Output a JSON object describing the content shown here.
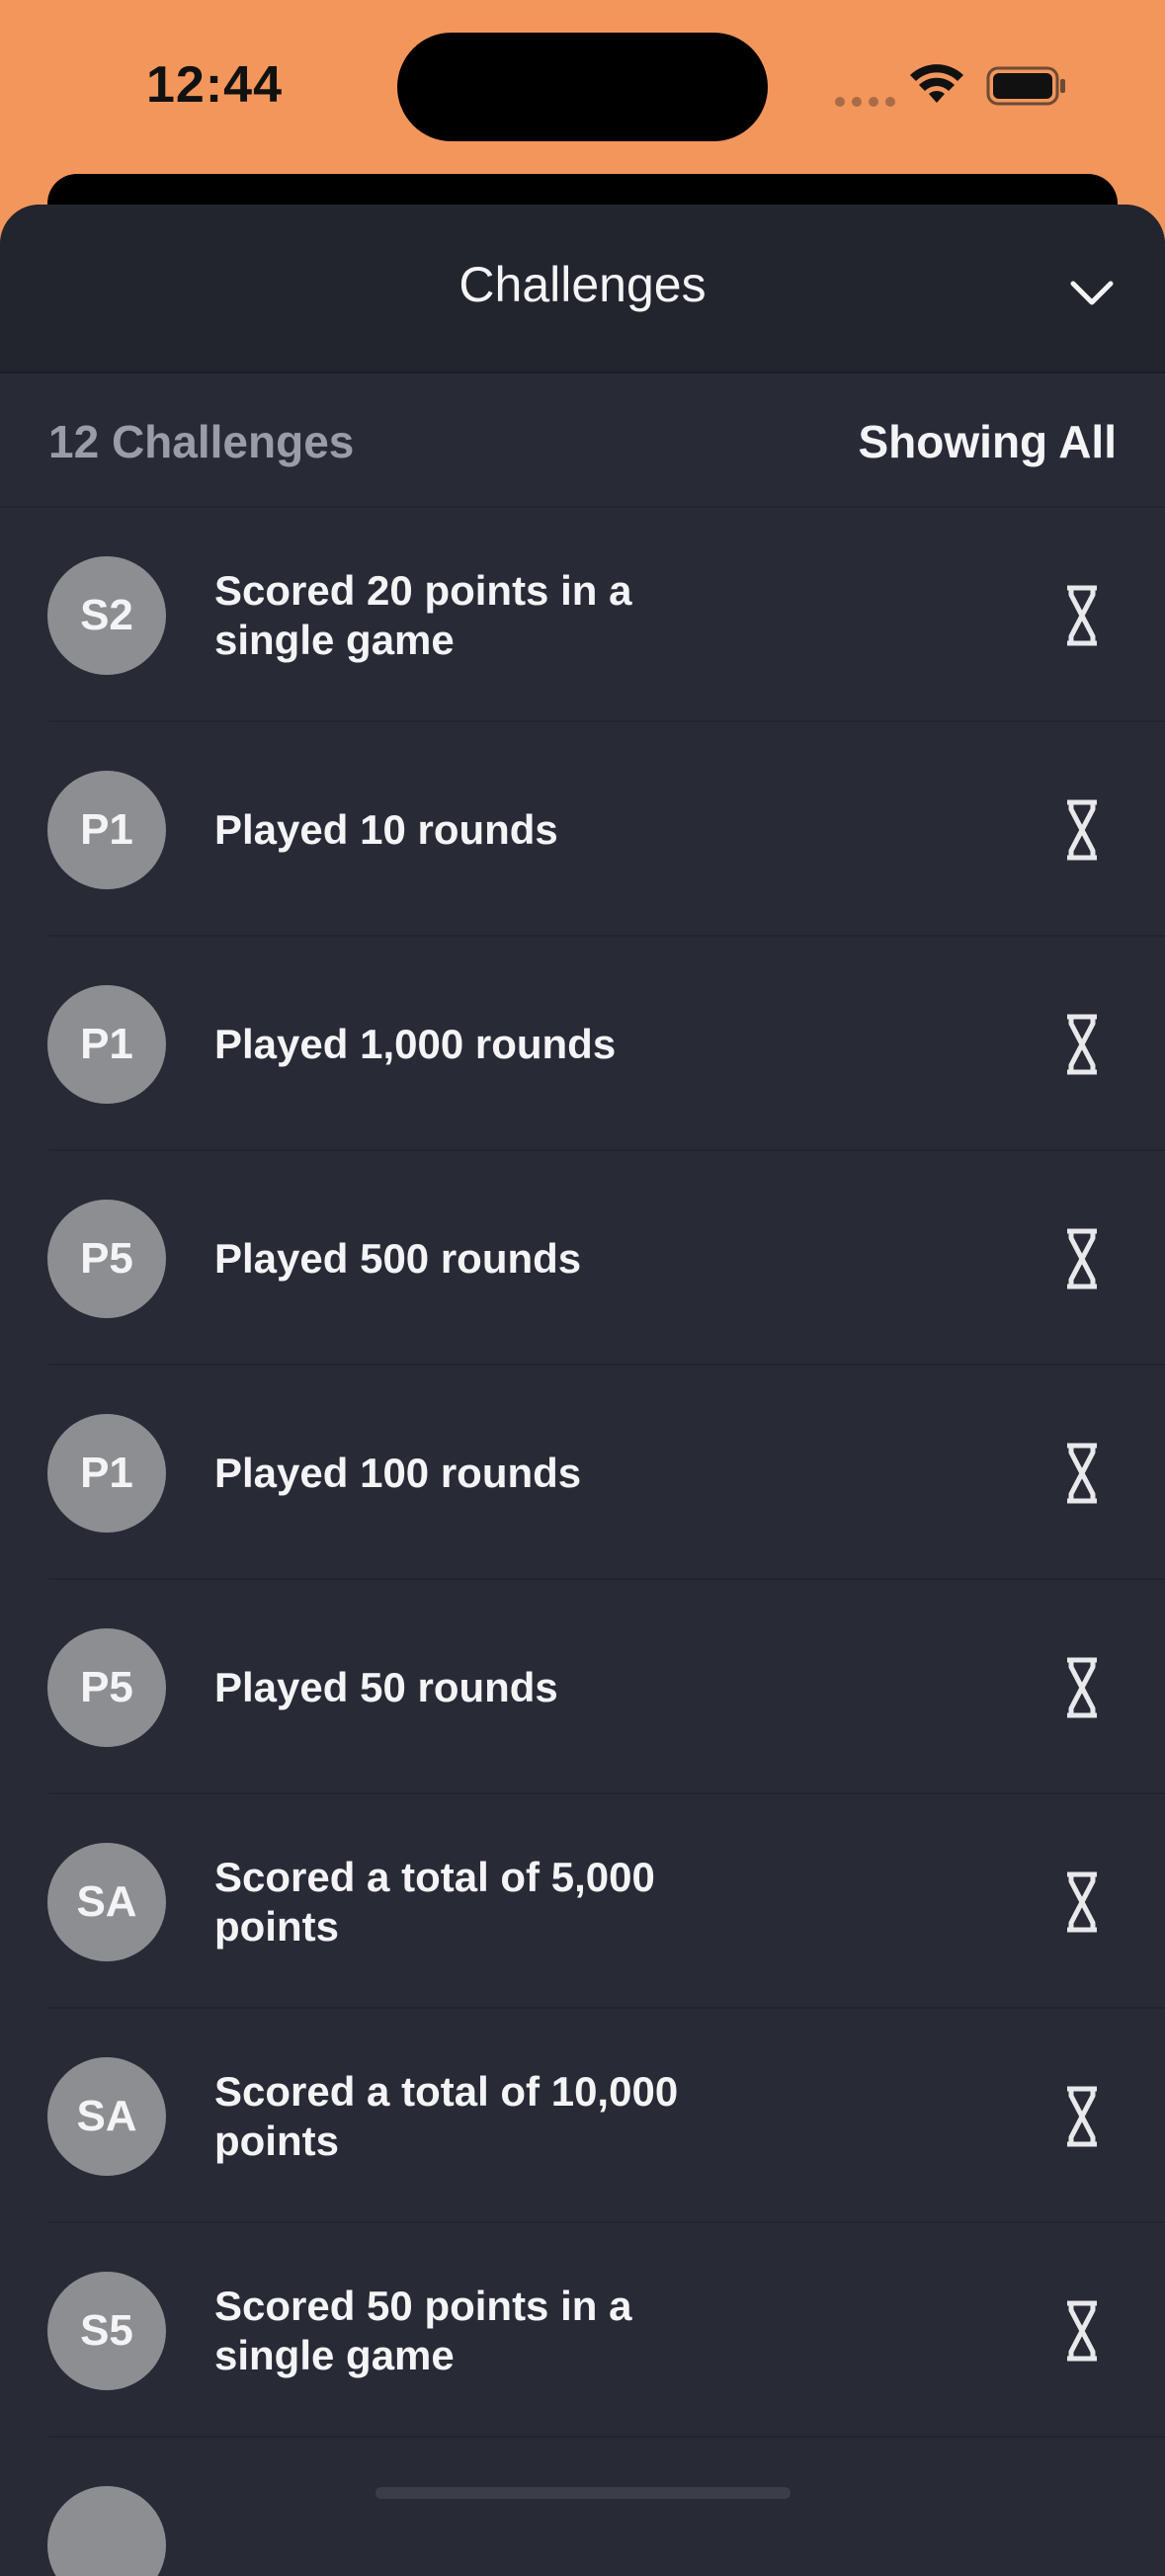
{
  "status_bar": {
    "time": "12:44"
  },
  "sheet": {
    "title": "Challenges",
    "count_label": "12 Challenges",
    "filter_label": "Showing All"
  },
  "challenges": [
    {
      "badge": "S2",
      "text": "Scored 20 points in a single game",
      "status_icon": "hourglass-icon"
    },
    {
      "badge": "P1",
      "text": "Played 10 rounds",
      "status_icon": "hourglass-icon"
    },
    {
      "badge": "P1",
      "text": "Played 1,000 rounds",
      "status_icon": "hourglass-icon"
    },
    {
      "badge": "P5",
      "text": "Played 500 rounds",
      "status_icon": "hourglass-icon"
    },
    {
      "badge": "P1",
      "text": "Played 100 rounds",
      "status_icon": "hourglass-icon"
    },
    {
      "badge": "P5",
      "text": "Played 50 rounds",
      "status_icon": "hourglass-icon"
    },
    {
      "badge": "SA",
      "text": "Scored a total of 5,000 points",
      "status_icon": "hourglass-icon"
    },
    {
      "badge": "SA",
      "text": "Scored a total of 10,000 points",
      "status_icon": "hourglass-icon"
    },
    {
      "badge": "S5",
      "text": "Scored 50 points in a single game",
      "status_icon": "hourglass-icon"
    },
    {
      "badge": "",
      "text": "",
      "status_icon": "hourglass-icon"
    }
  ],
  "colors": {
    "background_accent": "#F2965B",
    "sheet_background": "#282A36",
    "badge_background": "#8C8E92"
  }
}
